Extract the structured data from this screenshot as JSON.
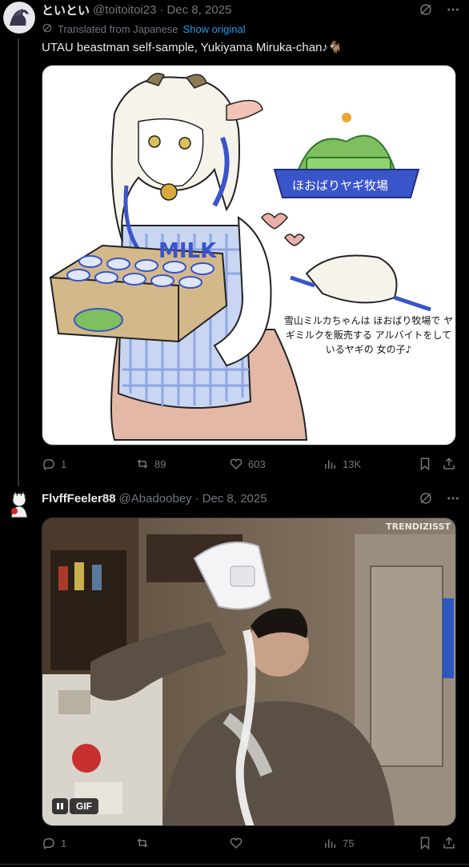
{
  "tweets": [
    {
      "name": "といとい",
      "handle": "@toitoitoi23",
      "date": "Dec 8, 2025",
      "translated_label": "Translated from Japanese",
      "show_original": "Show original",
      "text": "UTAU beastman self-sample, Yukiyama Miruka-chan♪🐐",
      "media_alt_text": "雪山ミルカちゃんは ほおばり牧場で ヤギミルクを販売する アルバイトをしているヤギの 女の子♪",
      "media_banner_text": "ほおばりヤギ牧場",
      "media_box_text": "MILK",
      "stats": {
        "replies": "1",
        "reposts": "89",
        "likes": "603",
        "views": "13K"
      }
    },
    {
      "name": "FlvffFeeler88",
      "handle": "@Abadoobey",
      "date": "Dec 8, 2025",
      "gif_label": "GIF",
      "watermark": "TRENDIZISST",
      "stats": {
        "replies": "1",
        "reposts": "",
        "likes": "",
        "views": "75"
      }
    }
  ],
  "colors": {
    "accent": "#1d9bf0",
    "muted": "#71767b",
    "text": "#e7e9ea",
    "bg": "#000000"
  },
  "icons": [
    "grok-icon",
    "more-icon",
    "translate-icon",
    "reply-icon",
    "repost-icon",
    "like-icon",
    "views-icon",
    "bookmark-icon",
    "share-icon",
    "pause-icon"
  ]
}
